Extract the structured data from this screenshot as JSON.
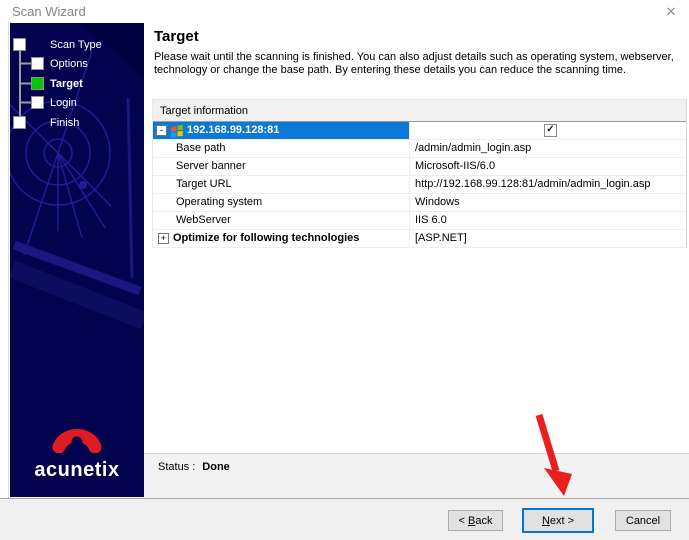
{
  "window": {
    "title": "Scan Wizard",
    "close_glyph": "✕"
  },
  "sidebar": {
    "steps": [
      {
        "label": "Scan Type",
        "active": false
      },
      {
        "label": "Options",
        "active": false
      },
      {
        "label": "Target",
        "active": true
      },
      {
        "label": "Login",
        "active": false
      },
      {
        "label": "Finish",
        "active": false
      }
    ],
    "logo_text": "acunetix"
  },
  "main": {
    "heading": "Target",
    "description_line1": "Please wait until the scanning is finished. You can also adjust details such as operating system, webserver,",
    "description_line2": "technology or change the base path. By entering these details you can reduce the scanning time.",
    "table": {
      "header": "Target information",
      "host_row": {
        "collapse_glyph": "-",
        "name": "192.168.99.128:81",
        "checked": true,
        "check_glyph": "✓"
      },
      "rows": [
        {
          "name": "Base path",
          "value": "/admin/admin_login.asp"
        },
        {
          "name": "Server banner",
          "value": "Microsoft-IIS/6.0"
        },
        {
          "name": "Target URL",
          "value": "http://192.168.99.128:81/admin/admin_login.asp"
        },
        {
          "name": "Operating system",
          "value": "Windows"
        },
        {
          "name": "WebServer",
          "value": "IIS 6.0"
        }
      ],
      "optimize_row": {
        "expand_glyph": "+",
        "name": "Optimize for following technologies",
        "value": "[ASP.NET]"
      }
    },
    "status_label": "Status :",
    "status_value": "Done"
  },
  "buttons": {
    "back": {
      "prefix": "< ",
      "underline": "B",
      "rest": "ack"
    },
    "next": {
      "underline": "N",
      "rest": "ext >"
    },
    "cancel": {
      "label": "Cancel"
    }
  },
  "icons": {
    "host_icon": "windows-flag-icon",
    "annotation": "red-arrow-pointing-at-next-button"
  },
  "colors": {
    "selection_blue": "#0c79d8",
    "sidebar_navy": "#02024e",
    "radar_blue": "#1e1e96",
    "step_green": "#00c800",
    "logo_red": "#e01b22",
    "arrow_red": "#e9201d",
    "next_border": "#0077d4"
  }
}
